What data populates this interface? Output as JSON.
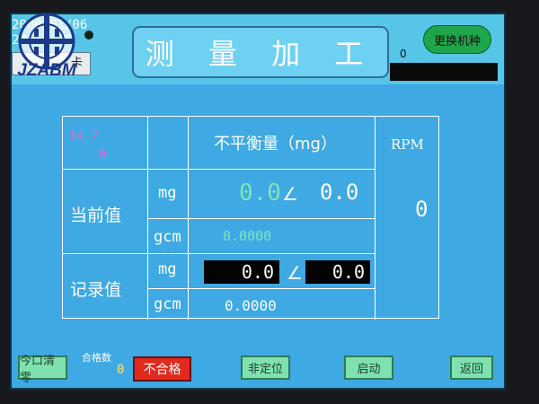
{
  "header": {
    "title": "测 量 加 工",
    "datetime_line1": "2000/01/06",
    "datetime_line2": "23:50:26",
    "card_label": "卡",
    "logo_text": "JZABM",
    "change_button": "更换机种",
    "count_value": "0"
  },
  "table": {
    "corner_line1": "14.7",
    "corner_line2": "0",
    "unbalance_header": "不平衡量（mg）",
    "rpm_header": "RPM",
    "rpm_value": "0",
    "current": {
      "label": "当前值",
      "mg_unit": "mg",
      "gcm_unit": "gcm",
      "mg_value": "0.0",
      "angle_symbol": "∠",
      "angle_value": "0.0",
      "gcm_value": "0.0000"
    },
    "record": {
      "label": "记录值",
      "mg_unit": "mg",
      "gcm_unit": "gcm",
      "mg_value": "0.0",
      "angle_symbol": "∠",
      "angle_value": "0.0",
      "gcm_value": "0.0000"
    }
  },
  "footer": {
    "qualified_label": "合格数",
    "qualified_value": "0",
    "buttons": {
      "clear": "今口清零",
      "fail": "不合格",
      "non_position": "非定位",
      "start": "启动",
      "back": "返回"
    }
  },
  "colors": {
    "screen_bg": "#3ea9e2",
    "accent_green": "#7fe2ae",
    "fail_red": "#e12a1e"
  }
}
